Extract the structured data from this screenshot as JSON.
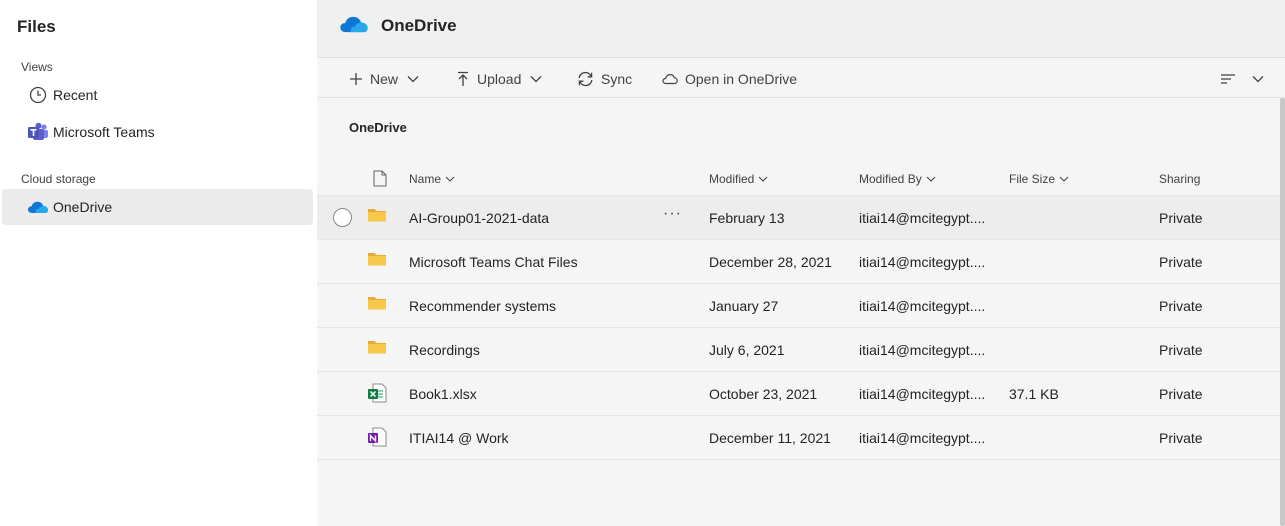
{
  "sidebar": {
    "title": "Files",
    "views_label": "Views",
    "items": [
      {
        "label": "Recent",
        "icon": "clock-icon"
      },
      {
        "label": "Microsoft Teams",
        "icon": "teams-icon"
      }
    ],
    "cloud_label": "Cloud storage",
    "cloud_items": [
      {
        "label": "OneDrive",
        "icon": "onedrive-cloud-icon",
        "selected": true
      }
    ]
  },
  "header": {
    "title": "OneDrive"
  },
  "toolbar": {
    "new_label": "New",
    "upload_label": "Upload",
    "sync_label": "Sync",
    "open_label": "Open in OneDrive"
  },
  "breadcrumb": "OneDrive",
  "table": {
    "columns": {
      "name": "Name",
      "modified": "Modified",
      "modified_by": "Modified By",
      "file_size": "File Size",
      "sharing": "Sharing"
    },
    "rows": [
      {
        "type": "folder",
        "name": "AI-Group01-2021-data",
        "modified": "February 13",
        "modified_by": "itiai14@mcitegypt....",
        "size": "",
        "sharing": "Private"
      },
      {
        "type": "folder",
        "name": "Microsoft Teams Chat Files",
        "modified": "December 28, 2021",
        "modified_by": "itiai14@mcitegypt....",
        "size": "",
        "sharing": "Private"
      },
      {
        "type": "folder",
        "name": "Recommender systems",
        "modified": "January 27",
        "modified_by": "itiai14@mcitegypt....",
        "size": "",
        "sharing": "Private"
      },
      {
        "type": "folder",
        "name": "Recordings",
        "modified": "July 6, 2021",
        "modified_by": "itiai14@mcitegypt....",
        "size": "",
        "sharing": "Private"
      },
      {
        "type": "excel",
        "name": "Book1.xlsx",
        "modified": "October 23, 2021",
        "modified_by": "itiai14@mcitegypt....",
        "size": "37.1 KB",
        "sharing": "Private"
      },
      {
        "type": "onenote",
        "name": "ITIAI14 @ Work",
        "modified": "December 11, 2021",
        "modified_by": "itiai14@mcitegypt....",
        "size": "",
        "sharing": "Private"
      }
    ],
    "more_glyph": "···"
  },
  "colors": {
    "accent": "#0f6cbd",
    "folder": "#f8c84a",
    "excel": "#107c41",
    "onenote": "#7719aa",
    "teams": "#5b5fc7"
  }
}
